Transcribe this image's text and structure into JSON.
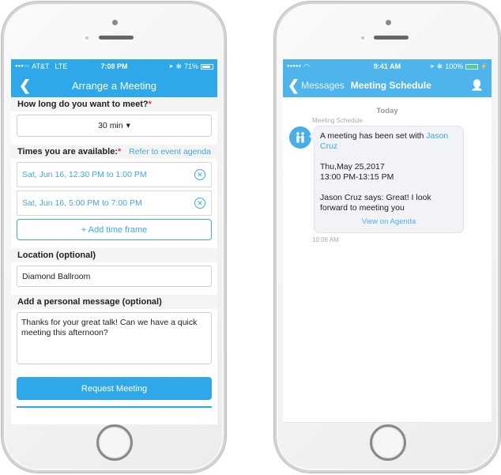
{
  "left_phone": {
    "status_bar": {
      "signal": "●●●○○",
      "carrier": "AT&T",
      "network": "LTE",
      "time": "7:08 PM",
      "location_icon": "➤",
      "bluetooth_icon": "✱",
      "battery_percent": "71%",
      "battery_level": 0.71
    },
    "nav": {
      "back_icon": "❮",
      "title": "Arrange a Meeting"
    },
    "duration": {
      "label": "How long do you want to meet?",
      "required_mark": "*",
      "selected": "30 min",
      "dropdown_icon": "▾"
    },
    "times": {
      "label": "Times you are available:",
      "required_mark": "*",
      "agenda_link": "Refer to event agenda",
      "items": [
        {
          "text": "Sat, Jun 16, 12:30 PM to 1:00 PM",
          "remove_icon": "✕"
        },
        {
          "text": "Sat, Jun 16, 5:00 PM to 7:00 PM",
          "remove_icon": "✕"
        }
      ],
      "add_button": "+ Add time frame"
    },
    "location": {
      "label": "Location (optional)",
      "value": "Diamond Ballroom"
    },
    "message": {
      "label": "Add a personal message (optional)",
      "value": "Thanks for your great talk! Can we have a quick meeting this afternoon?"
    },
    "submit_button": "Request Meeting"
  },
  "right_phone": {
    "status_bar": {
      "signal": "●●●●●",
      "wifi_icon": "◠",
      "time": "9:41 AM",
      "location_icon": "➤",
      "bluetooth_icon": "✱",
      "battery_percent": "100%",
      "battery_level": 1.0,
      "charging_icon": "⚡"
    },
    "nav": {
      "back_icon": "❮",
      "back_label": "Messages",
      "title": "Meeting Schedule",
      "profile_icon": "👤"
    },
    "chat": {
      "date_separator": "Today",
      "sender": "Meeting Schedule",
      "avatar_icon": "👫",
      "message": {
        "line1_prefix": "A meeting has been set with ",
        "line1_name": "Jason Cruz",
        "date": "Thu,May 25,2017",
        "time_range": "13:00 PM-13:15 PM",
        "reply": "Jason Cruz says: Great! I look forward to meeting you",
        "link": "View on Agenda"
      },
      "timestamp": "10:06 AM"
    }
  }
}
